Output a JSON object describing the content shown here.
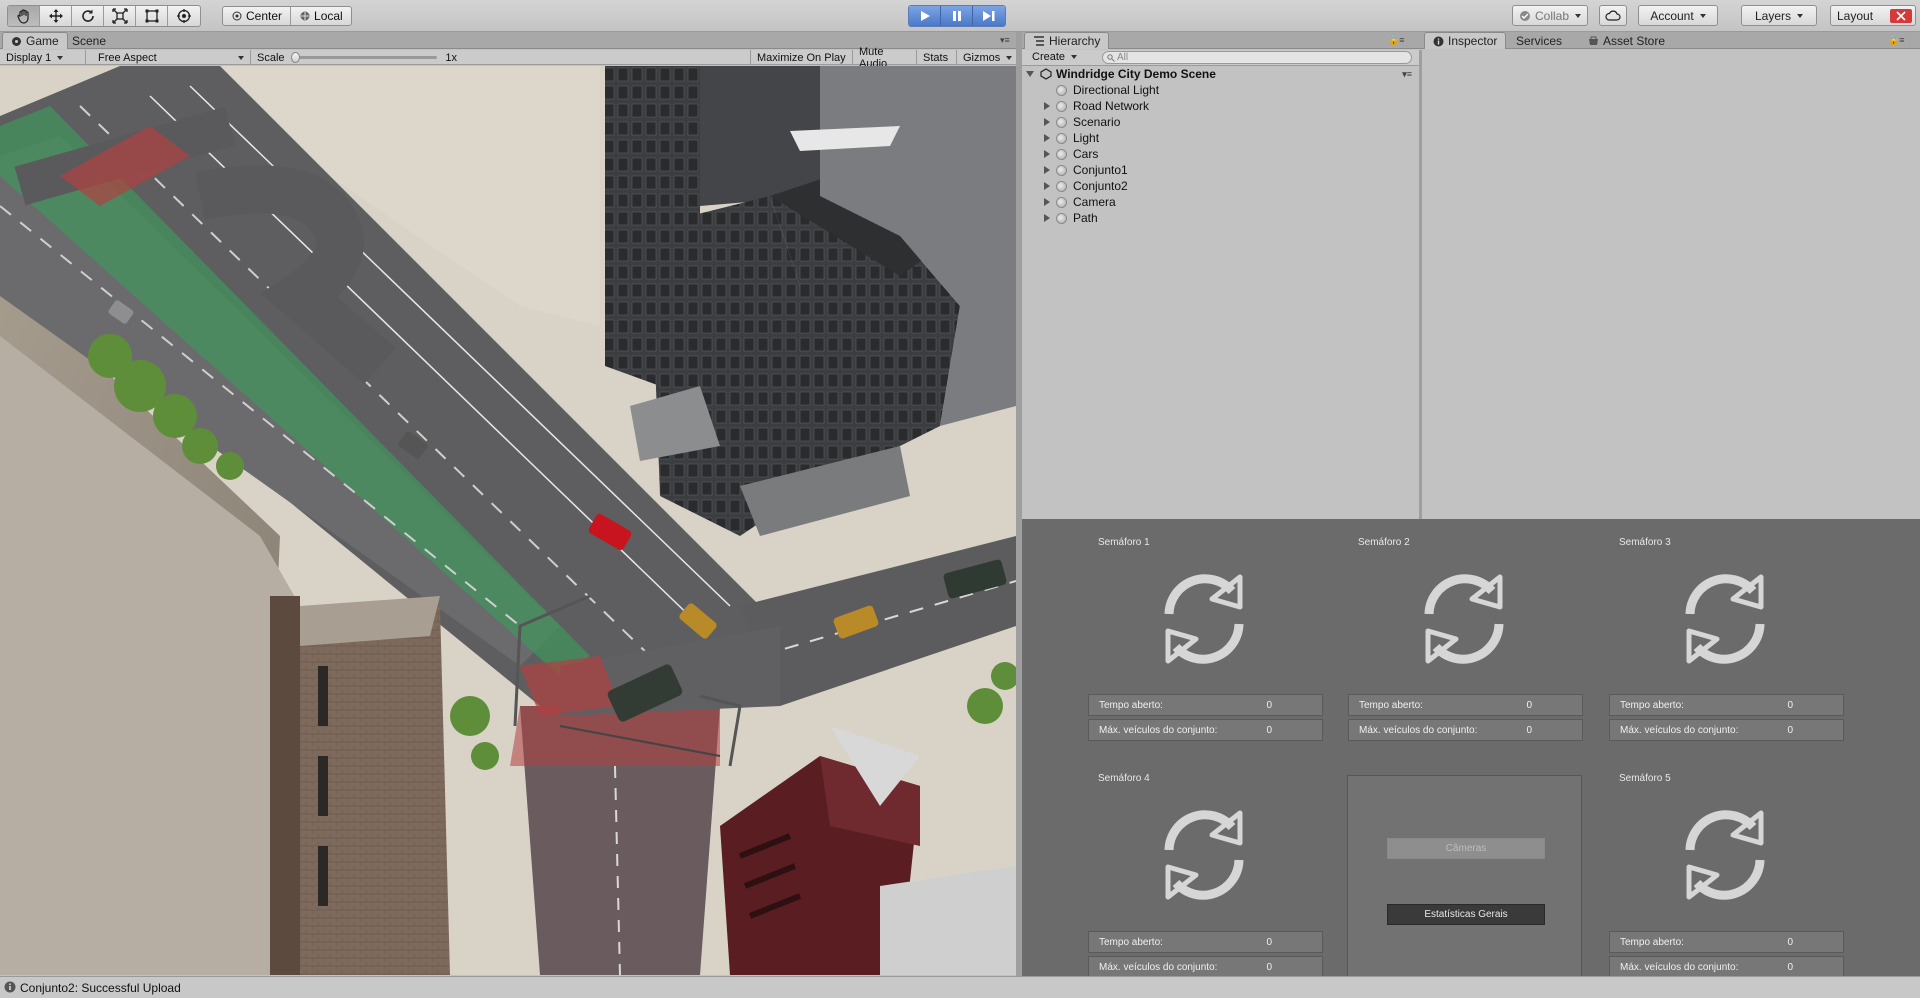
{
  "toolbar": {
    "pivot_center": "Center",
    "pivot_local": "Local",
    "collab": "Collab",
    "account": "Account",
    "layers": "Layers",
    "layout": "Layout"
  },
  "game_panel": {
    "tabs": [
      "Game",
      "Scene"
    ],
    "display": "Display 1",
    "aspect": "Free Aspect",
    "scale_label": "Scale",
    "scale_value": "1x",
    "maximize": "Maximize On Play",
    "mute": "Mute Audio",
    "stats": "Stats",
    "gizmos": "Gizmos"
  },
  "hierarchy": {
    "tab": "Hierarchy",
    "create": "Create",
    "search_placeholder": "All",
    "scene": "Windridge City Demo Scene",
    "items": [
      "Directional Light",
      "Road Network",
      "Scenario",
      "Light",
      "Cars",
      "Conjunto1",
      "Conjunto2",
      "Camera",
      "Path"
    ]
  },
  "inspector_tabs": [
    "Inspector",
    "Services",
    "Asset Store"
  ],
  "semaforos": [
    {
      "title": "Semáforo 1",
      "tempo_label": "Tempo aberto:",
      "tempo": "0",
      "max_label": "Máx. veículos do conjunto:",
      "max": "0"
    },
    {
      "title": "Semáforo 2",
      "tempo_label": "Tempo aberto:",
      "tempo": "0",
      "max_label": "Máx. veículos do conjunto:",
      "max": "0"
    },
    {
      "title": "Semáforo 3",
      "tempo_label": "Tempo aberto:",
      "tempo": "0",
      "max_label": "Máx. veículos do conjunto:",
      "max": "0"
    },
    {
      "title": "Semáforo 4",
      "tempo_label": "Tempo aberto:",
      "tempo": "0",
      "max_label": "Máx. veículos do conjunto:",
      "max": "0"
    },
    {
      "title": "Semáforo 5",
      "tempo_label": "Tempo aberto:",
      "tempo": "0",
      "max_label": "Máx. veículos do conjunto:",
      "max": "0"
    }
  ],
  "center_buttons": {
    "cameras": "Câmeras",
    "stats": "Estatísticas Gerais"
  },
  "status": "Conjunto2: Successful Upload",
  "colors": {
    "play_active": "#4a78c8",
    "panel_bg": "#6b6b6b",
    "editor_bg": "#c2c2c2",
    "car_red": "#c8141e",
    "crosswalk_green": "#3c9a5a",
    "crosswalk_red": "#b04040"
  }
}
